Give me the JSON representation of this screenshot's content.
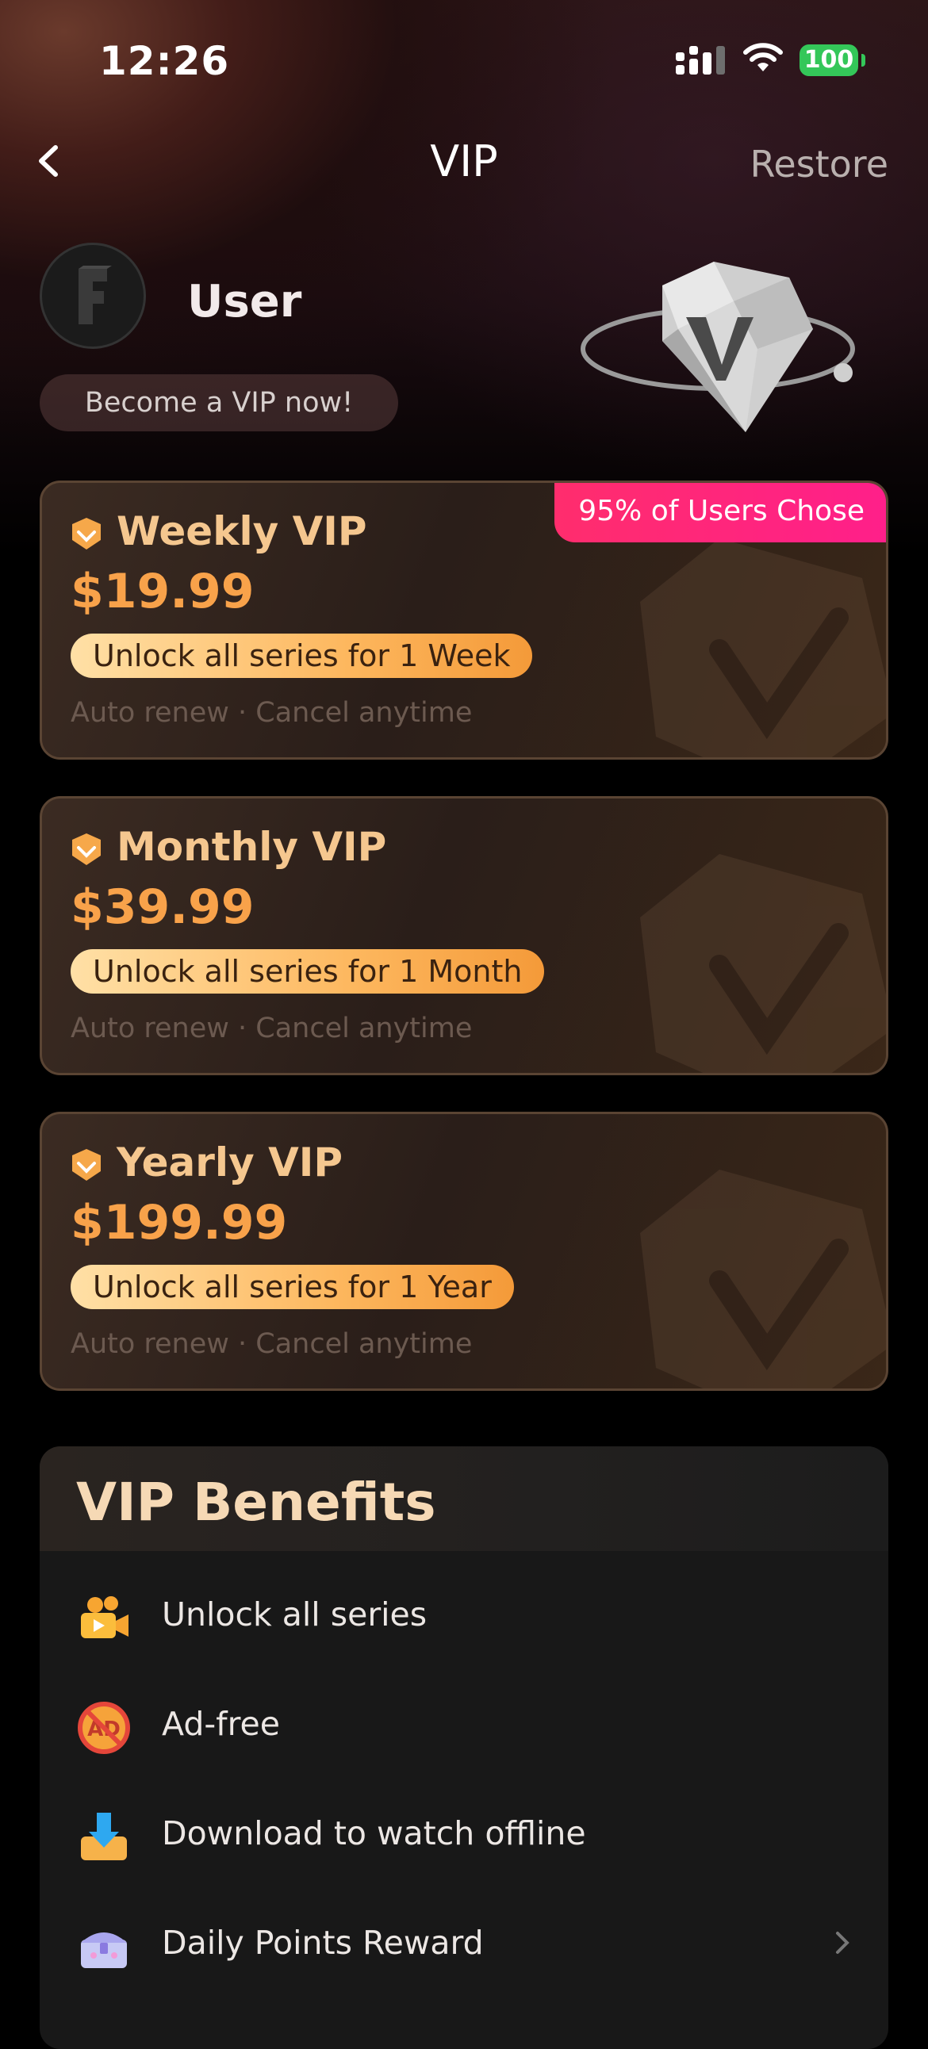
{
  "status_bar": {
    "time": "12:26",
    "battery": "100"
  },
  "nav": {
    "title": "VIP",
    "restore_label": "Restore"
  },
  "profile": {
    "username": "User",
    "cta": "Become a VIP now!"
  },
  "popular_badge": "95% of Users Chose",
  "plans": [
    {
      "name": "Weekly VIP",
      "price": "$19.99",
      "pill": "Unlock all series for 1 Week",
      "note": "Auto renew · Cancel anytime"
    },
    {
      "name": "Monthly VIP",
      "price": "$39.99",
      "pill": "Unlock all series for 1 Month",
      "note": "Auto renew · Cancel anytime"
    },
    {
      "name": "Yearly VIP",
      "price": "$199.99",
      "pill": "Unlock all series for 1 Year",
      "note": "Auto renew · Cancel anytime"
    }
  ],
  "benefits": {
    "title": "VIP Benefits",
    "items": [
      {
        "label": "Unlock all series",
        "icon": "movie-camera-icon"
      },
      {
        "label": "Ad-free",
        "icon": "no-ads-icon"
      },
      {
        "label": "Download to watch offline",
        "icon": "download-tray-icon"
      },
      {
        "label": "Daily Points Reward",
        "icon": "reward-chest-icon"
      }
    ]
  },
  "colors": {
    "accent": "#f8a24a",
    "badge": "#ff2d6d",
    "battery": "#34c759"
  }
}
